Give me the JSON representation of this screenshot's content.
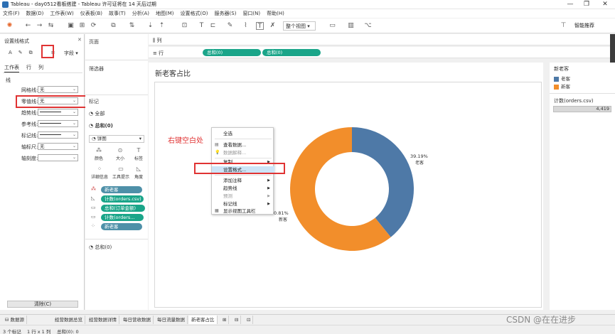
{
  "window": {
    "title": "Tableau - day0512看板搭建 - Tableau 许可证将在 14 天后过期",
    "controls": [
      "—",
      "❐",
      "✕"
    ]
  },
  "menu": [
    "文件(F)",
    "数据(D)",
    "工作表(W)",
    "仪表板(B)",
    "故事(T)",
    "分析(A)",
    "地图(M)",
    "设置格式(O)",
    "服务器(S)",
    "窗口(N)",
    "帮助(H)"
  ],
  "toolbar": {
    "fit_label": "整个视图",
    "smart_label": "智能推荐"
  },
  "format_pane": {
    "title": "设置线格式",
    "close": "✕",
    "icons": [
      "A",
      "✎",
      "⧉",
      "≡"
    ],
    "field_label": "字段 ▾",
    "tabs": [
      "工作表",
      "行",
      "列"
    ],
    "section": "线",
    "rows": [
      {
        "label": "网格线:",
        "value": "无"
      },
      {
        "label": "零值线:",
        "value": "无"
      },
      {
        "label": "趋势线:",
        "value": ""
      },
      {
        "label": "参考线:",
        "value": ""
      },
      {
        "label": "标记线:",
        "value": ""
      },
      {
        "label": "轴标尺:",
        "value": "无"
      },
      {
        "label": "轴刻度:",
        "value": ""
      }
    ],
    "clear_label": "清除(C)"
  },
  "pages_label": "页面",
  "filters_label": "筛选器",
  "marks": {
    "title": "标记",
    "all": "全部",
    "sum0": "总和(0)",
    "mark_type": "饼图",
    "buttons": [
      "颜色",
      "大小",
      "标签",
      "详细信息",
      "工具提示",
      "角度"
    ],
    "pills": [
      "新老客",
      "计数(orders.csv)",
      "总和(订单金额)",
      "计数(orders...",
      "新老客"
    ],
    "sum1": "总和(0)"
  },
  "shelves": {
    "columns_label": "列",
    "rows_label": "行",
    "row_pills": [
      "总和(0)",
      "总和(0)"
    ]
  },
  "view": {
    "title": "新老客占比"
  },
  "annotation": "右键空白处",
  "context_menu": {
    "items": [
      {
        "label": "全选",
        "disabled": false,
        "submenu": false,
        "highlight": false
      },
      {
        "label": "查看数据...",
        "disabled": false,
        "submenu": false,
        "highlight": false
      },
      {
        "label": "数据解释...",
        "disabled": true,
        "submenu": false,
        "highlight": false
      },
      {
        "label": "复制",
        "disabled": false,
        "submenu": true,
        "highlight": false
      },
      {
        "label": "设置格式...",
        "disabled": false,
        "submenu": false,
        "highlight": true
      },
      {
        "label": "添加注释",
        "disabled": false,
        "submenu": true,
        "highlight": false
      },
      {
        "label": "趋势线",
        "disabled": false,
        "submenu": true,
        "highlight": false
      },
      {
        "label": "预测",
        "disabled": true,
        "submenu": true,
        "highlight": false
      },
      {
        "label": "标记线",
        "disabled": false,
        "submenu": true,
        "highlight": false
      },
      {
        "label": "显示视图工具栏",
        "disabled": false,
        "submenu": false,
        "highlight": false
      }
    ]
  },
  "chart_data": {
    "type": "pie",
    "categories": [
      "老客",
      "新客"
    ],
    "values": [
      39.19,
      60.81
    ],
    "labels": [
      "39.19%",
      "0.81%"
    ],
    "colors": [
      "#4e79a7",
      "#f28e2b"
    ],
    "donut": true
  },
  "legend": {
    "title": "新老客",
    "items": [
      {
        "label": "老客",
        "color": "#4e79a7"
      },
      {
        "label": "新客",
        "color": "#f28e2b"
      }
    ]
  },
  "count_card": {
    "title": "计数(orders.csv)",
    "value": "4,419"
  },
  "sheet_tabs": [
    "数据源",
    "经营数据总览",
    "经营数据详情",
    "每日营收数据",
    "每日流量数据",
    "新老客占比"
  ],
  "active_tab": "新老客占比",
  "status": {
    "marks": "3 个标记",
    "rows_cols": "1 行 x 1 列",
    "sum": "总和(0): 0"
  },
  "watermark": "CSDN @在在进步"
}
